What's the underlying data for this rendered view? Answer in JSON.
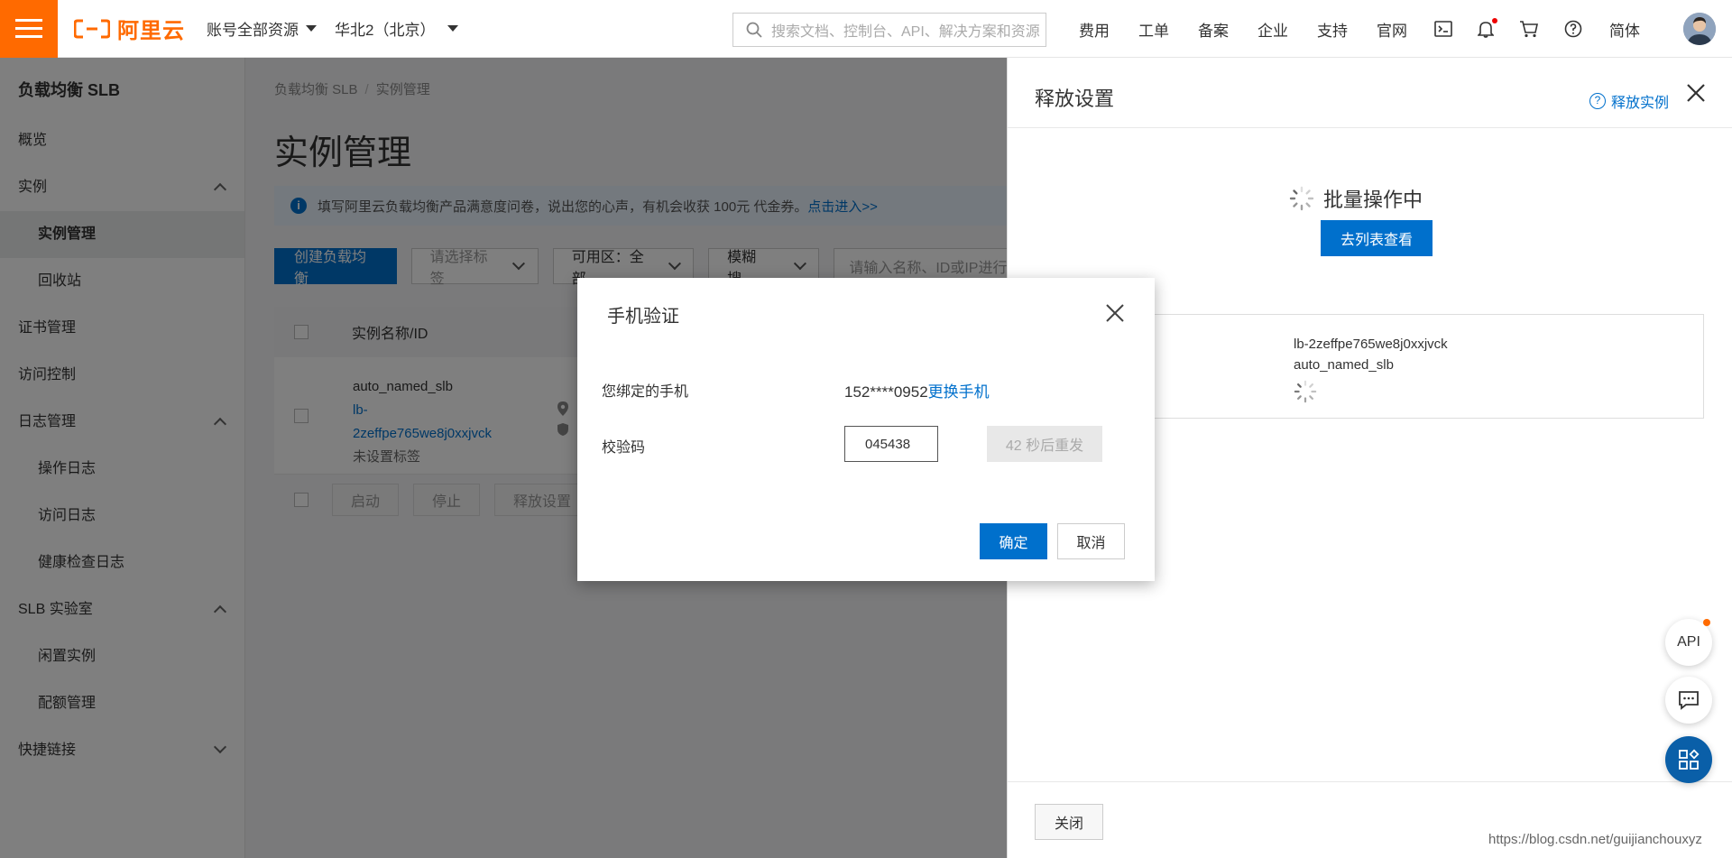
{
  "header": {
    "logo_text": "阿里云",
    "account_dropdown": "账号全部资源",
    "region_dropdown": "华北2（北京）",
    "search_placeholder": "搜索文档、控制台、API、解决方案和资源",
    "links": [
      "费用",
      "工单",
      "备案",
      "企业",
      "支持",
      "官网"
    ],
    "language": "简体",
    "icons": [
      "terminal-icon",
      "bell-icon",
      "cart-icon",
      "help-icon"
    ]
  },
  "sidebar": {
    "title": "负载均衡 SLB",
    "items": [
      {
        "label": "概览",
        "level": 0
      },
      {
        "label": "实例",
        "level": 0,
        "expanded": true
      },
      {
        "label": "实例管理",
        "level": 1,
        "active": true
      },
      {
        "label": "回收站",
        "level": 1
      },
      {
        "label": "证书管理",
        "level": 0
      },
      {
        "label": "访问控制",
        "level": 0
      },
      {
        "label": "日志管理",
        "level": 0,
        "expanded": true
      },
      {
        "label": "操作日志",
        "level": 1
      },
      {
        "label": "访问日志",
        "level": 1
      },
      {
        "label": "健康检查日志",
        "level": 1
      },
      {
        "label": "SLB 实验室",
        "level": 0,
        "expanded": true
      },
      {
        "label": "闲置实例",
        "level": 1
      },
      {
        "label": "配额管理",
        "level": 1
      },
      {
        "label": "快捷链接",
        "level": 0,
        "expanded": false
      }
    ]
  },
  "main": {
    "breadcrumb": [
      "负载均衡 SLB",
      "实例管理"
    ],
    "title": "实例管理",
    "notice_text": "填写阿里云负载均衡产品满意度问卷，说出您的心声，有机会收获 100元 代金券。",
    "notice_link": "点击进入>>",
    "create_button": "创建负载均衡",
    "tag_select_placeholder": "请选择标签",
    "zone_select": "可用区：全部",
    "search_mode": "模糊搜...",
    "search_placeholder": "请输入名称、ID或IP进行",
    "table": {
      "column_name": "实例名称/ID",
      "rows": [
        {
          "name": "auto_named_slb",
          "id_line1": "lb-",
          "id_line2": "2zeffpe765we8j0xxjvck",
          "tag": "未设置标签"
        }
      ]
    },
    "footer_buttons": [
      "启动",
      "停止",
      "释放设置"
    ]
  },
  "drawer": {
    "title": "释放设置",
    "help_link": "释放实例",
    "status": "批量操作中",
    "goto_list_button": "去列表查看",
    "instance_id": "lb-2zeffpe765we8j0xxjvck",
    "instance_name": "auto_named_slb",
    "close_button": "关闭"
  },
  "modal": {
    "title": "手机验证",
    "phone_label": "您绑定的手机",
    "phone_value": "152****0952",
    "change_phone_link": "更换手机",
    "code_label": "校验码",
    "code_value": "045438",
    "resend_label": "42 秒后重发",
    "ok_button": "确定",
    "cancel_button": "取消"
  },
  "floating": {
    "api_label": "API"
  },
  "watermark": "https://blog.csdn.net/guijianchouxyz",
  "colors": {
    "brand_orange": "#ff6a00",
    "primary_blue": "#0070cc"
  }
}
